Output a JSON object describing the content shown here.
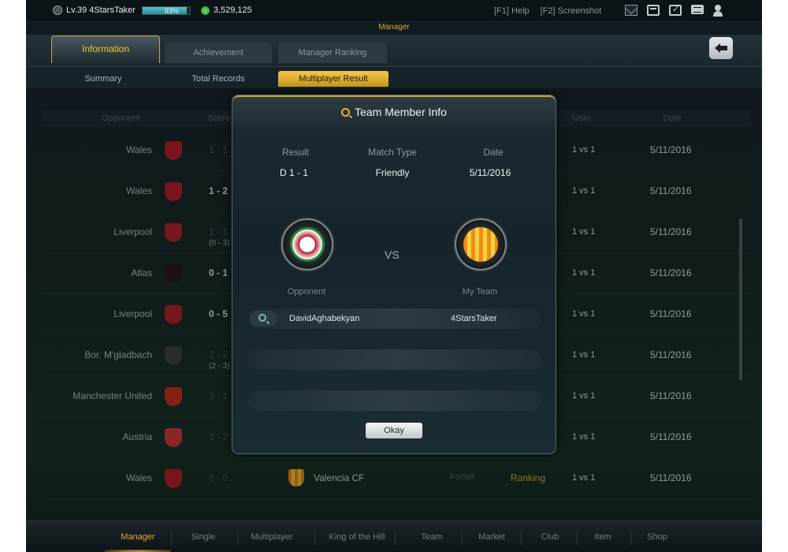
{
  "topbar": {
    "player_label": "Lv.39 4StarsTaker",
    "xp_percent": 93,
    "xp_text": "93%",
    "coins": "3,529,125",
    "help": "[F1] Help",
    "screenshot": "[F2] Screenshot",
    "icons": [
      "mail-icon",
      "calculator-icon",
      "calendar-check-icon",
      "chat-icon",
      "user-icon"
    ]
  },
  "section_title": "Manager",
  "main_tabs": [
    {
      "label": "Information",
      "active": true
    },
    {
      "label": "Achievement",
      "active": false
    },
    {
      "label": "Manager Ranking",
      "active": false
    }
  ],
  "sub_tabs": [
    {
      "label": "Summary",
      "active": false
    },
    {
      "label": "Total Records",
      "active": false
    },
    {
      "label": "Multiplayer Result",
      "active": true
    }
  ],
  "table": {
    "headers": {
      "opponent": "Opponent",
      "score": "Score",
      "user": "User",
      "date": "Date"
    },
    "rows": [
      {
        "opponent": "Wales",
        "score": "1 - 1",
        "score_dim": true,
        "pen": "",
        "mode": "1 vs 1",
        "date": "5/11/2016",
        "crest": "#b81f2a"
      },
      {
        "opponent": "Wales",
        "score": "1 - 2",
        "score_dim": false,
        "pen": "",
        "mode": "1 vs 1",
        "date": "5/11/2016",
        "crest": "#b81f2a"
      },
      {
        "opponent": "Liverpool",
        "score": "1 - 1",
        "score_dim": true,
        "pen": "(0 - 3)",
        "mode": "1 vs 1",
        "date": "5/11/2016",
        "crest": "#b3262c"
      },
      {
        "opponent": "Atlas",
        "score": "0 - 1",
        "score_dim": false,
        "pen": "",
        "mode": "1 vs 1",
        "date": "5/11/2016",
        "crest": "#2c1a1c"
      },
      {
        "opponent": "Liverpool",
        "score": "0 - 5",
        "score_dim": false,
        "pen": "",
        "mode": "1 vs 1",
        "date": "5/11/2016",
        "crest": "#b3262c"
      },
      {
        "opponent": "Bor. M'gladbach",
        "score": "2 - 2",
        "score_dim": true,
        "pen": "(2 - 3)",
        "mode": "1 vs 1",
        "date": "5/11/2016",
        "crest": "#3e4448"
      },
      {
        "opponent": "Manchester United",
        "score": "3 - 1",
        "score_dim": true,
        "pen": "",
        "mode": "1 vs 1",
        "date": "5/11/2016",
        "crest": "#c8341f"
      },
      {
        "opponent": "Austria",
        "score": "3 - 2",
        "score_dim": true,
        "pen": "",
        "mode": "1 vs 1",
        "date": "5/11/2016",
        "crest": "#d83a3a"
      },
      {
        "opponent": "Wales",
        "score": "5 - 0",
        "score_dim": true,
        "pen": "",
        "mode": "1 vs 1",
        "date": "5/11/2016",
        "crest": "#b81f2a",
        "my_team": "Valencia CF",
        "forfeit": "Forfeit",
        "ranking": "Ranking"
      }
    ]
  },
  "bottom_nav": [
    {
      "label": "Manager",
      "active": true
    },
    {
      "label": "Single",
      "active": false
    },
    {
      "label": "Multiplayer",
      "active": false
    },
    {
      "label": "King of the Hill",
      "active": false
    },
    {
      "label": "Team",
      "active": false
    },
    {
      "label": "Market",
      "active": false
    },
    {
      "label": "Club",
      "active": false
    },
    {
      "label": "Item",
      "active": false
    },
    {
      "label": "Shop",
      "active": false
    }
  ],
  "modal": {
    "title": "Team Member Info",
    "result_label": "Result",
    "result_value": "D 1 - 1",
    "match_type_label": "Match Type",
    "match_type_value": "Friendly",
    "date_label": "Date",
    "date_value": "5/11/2016",
    "vs": "VS",
    "opponent_label": "Opponent",
    "my_team_label": "My Team",
    "members": [
      {
        "opponent": "DavidAghabekyan",
        "me": "4StarsTaker"
      },
      {
        "opponent": "",
        "me": ""
      },
      {
        "opponent": "",
        "me": ""
      }
    ],
    "okay": "Okay"
  },
  "colors": {
    "accent_gold": "#e4a933",
    "wales_red": "#b81f2a",
    "valencia_orange": "#f08a1a"
  }
}
